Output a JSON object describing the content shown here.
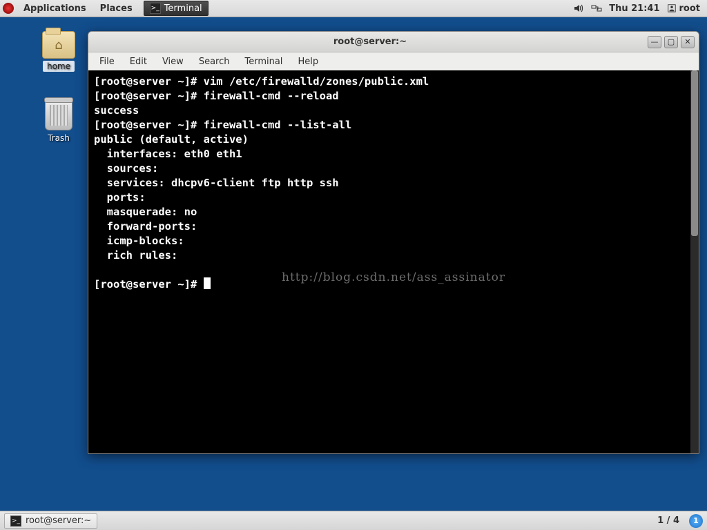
{
  "top_panel": {
    "applications": "Applications",
    "places": "Places",
    "task_label": "Terminal",
    "clock": "Thu 21:41",
    "user": "root"
  },
  "desktop": {
    "home_label": "home",
    "trash_label": "Trash"
  },
  "window": {
    "title": "root@server:~",
    "menu": {
      "file": "File",
      "edit": "Edit",
      "view": "View",
      "search": "Search",
      "terminal": "Terminal",
      "help": "Help"
    }
  },
  "terminal": {
    "prompt": "[root@server ~]# ",
    "lines": {
      "l1_cmd": "vim /etc/firewalld/zones/public.xml",
      "l2_cmd": "firewall-cmd --reload",
      "l3": "success",
      "l4_cmd": "firewall-cmd --list-all",
      "l5": "public (default, active)",
      "l6": "  interfaces: eth0 eth1",
      "l7": "  sources: ",
      "l8": "  services: dhcpv6-client ftp http ssh",
      "l9": "  ports: ",
      "l10": "  masquerade: no",
      "l11": "  forward-ports: ",
      "l12": "  icmp-blocks: ",
      "l13": "  rich rules: ",
      "blank": "\t"
    },
    "watermark": "http://blog.csdn.net/ass_assinator"
  },
  "bottom_panel": {
    "task_label": "root@server:~",
    "workspace": "1 / 4",
    "badge": "1"
  }
}
